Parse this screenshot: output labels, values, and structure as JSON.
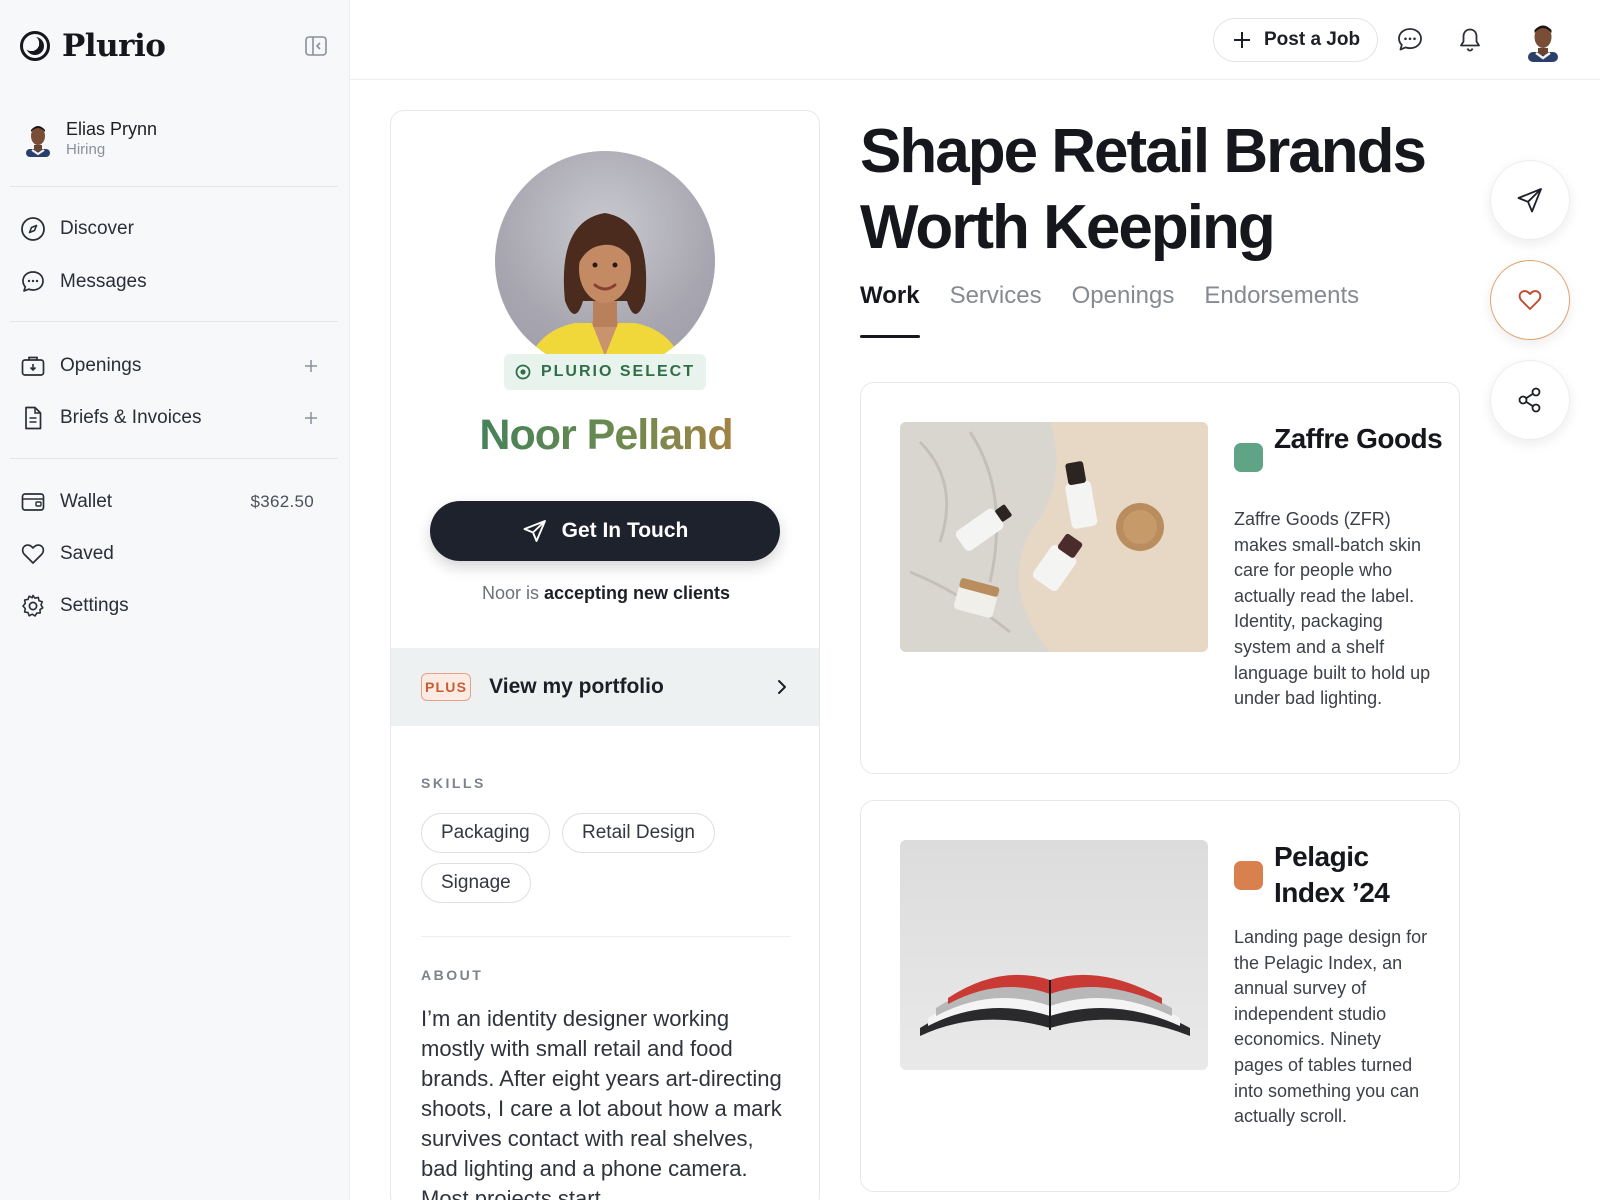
{
  "app": {
    "name": "Plurio"
  },
  "sidebar": {
    "user": {
      "name": "Elias Prynn",
      "role": "Hiring"
    },
    "nav_primary": [
      {
        "label": "Discover",
        "icon": "compass-icon"
      },
      {
        "label": "Messages",
        "icon": "chat-bubble-icon"
      }
    ],
    "nav_work": [
      {
        "label": "Openings",
        "icon": "briefcase-icon"
      },
      {
        "label": "Briefs & Invoices",
        "icon": "document-icon"
      }
    ],
    "nav_account": [
      {
        "label": "Wallet",
        "icon": "wallet-icon",
        "value": "$362.50"
      },
      {
        "label": "Saved",
        "icon": "heart-icon"
      },
      {
        "label": "Settings",
        "icon": "gear-icon"
      }
    ]
  },
  "topbar": {
    "post_job_label": "Post a Job"
  },
  "profile": {
    "badge": "PLURIO SELECT",
    "name": "Noor Pelland",
    "cta_label": "Get In Touch",
    "availability_prefix": "Noor is",
    "availability_status": "accepting new clients",
    "portfolio_badge": "PLUS",
    "portfolio_label": "View my portfolio",
    "skills_title": "SKILLS",
    "skills": [
      "Packaging",
      "Retail Design",
      "Signage"
    ],
    "about_title": "ABOUT",
    "about_text": "I’m an identity designer working mostly with small retail and food brands. After eight years art-directing shoots, I care a lot about how a mark survives contact with real shelves, bad lighting and a phone camera. Most projects start"
  },
  "main": {
    "headline": "Shape Retail Brands Worth Keeping",
    "tabs": [
      "Work",
      "Services",
      "Openings",
      "Endorsements"
    ],
    "active_tab": "Work",
    "works": [
      {
        "title": "Zaffre Goods",
        "description": "Zaffre Goods (ZFR) makes small-batch skin care for people who actually read the label. Identity, packaging system and a shelf language built to hold up under bad lighting.",
        "swatch_color": "#5fa585"
      },
      {
        "title": "Pelagic Index ’24",
        "description": "Landing page design for the Pelagic Index, an annual survey of independent studio economics. Ninety pages of tables turned into something you can actually scroll.",
        "swatch_color": "#d9804f"
      }
    ]
  },
  "colors": {
    "accent_green": "#2f6e49",
    "accent_orange": "#c85c34",
    "cta_dark": "#1e222c"
  }
}
